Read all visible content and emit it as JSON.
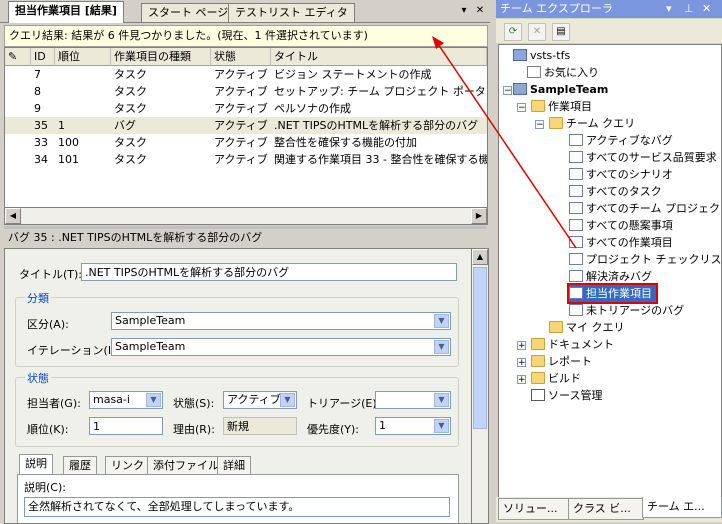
{
  "doc_tabs": [
    {
      "label": "担当作業項目 [結果]",
      "active": true
    },
    {
      "label": "スタート ページ",
      "active": false
    },
    {
      "label": "テストリスト エディタ",
      "active": false
    }
  ],
  "doc_controls": {
    "dropdown": "▾",
    "close": "✕"
  },
  "query_status": "クエリ結果: 結果が 6 件見つかりました。(現在、1 件選択されています)",
  "grid": {
    "columns": [
      "",
      "ID",
      "順位",
      "作業項目の種類",
      "状態",
      "タイトル"
    ],
    "rows": [
      {
        "id": "7",
        "rank": "",
        "type": "タスク",
        "state": "アクティブ",
        "title": "ビジョン ステートメントの作成",
        "selected": false
      },
      {
        "id": "8",
        "rank": "",
        "type": "タスク",
        "state": "アクティブ",
        "title": "セットアップ: チーム プロジェクト ポータルにプロ",
        "selected": false
      },
      {
        "id": "9",
        "rank": "",
        "type": "タスク",
        "state": "アクティブ",
        "title": "ペルソナの作成",
        "selected": false
      },
      {
        "id": "35",
        "rank": "1",
        "type": "バグ",
        "state": "アクティブ",
        "title": ".NET TIPSのHTMLを解析する部分のバグ",
        "selected": true
      },
      {
        "id": "33",
        "rank": "100",
        "type": "タスク",
        "state": "アクティブ",
        "title": "整合性を確保する機能の付加",
        "selected": false
      },
      {
        "id": "34",
        "rank": "101",
        "type": "タスク",
        "state": "アクティブ",
        "title": "関連する作業項目 33 - 整合性を確保する機",
        "selected": false
      }
    ]
  },
  "bug_header": "バグ 35 : .NET TIPSのHTMLを解析する部分のバグ",
  "form": {
    "title_label": "タイトル(T):",
    "title_value": ".NET TIPSのHTMLを解析する部分のバグ",
    "classification_group": "分類",
    "area_label": "区分(A):",
    "area_value": "SampleTeam",
    "iteration_label": "イテレーション(I):",
    "iteration_value": "SampleTeam",
    "status_group": "状態",
    "assigned_label": "担当者(G):",
    "assigned_value": "masa-i",
    "state_label": "状態(S):",
    "state_value": "アクティブ",
    "triage_label": "トリアージ(E):",
    "triage_value": "",
    "rank_label": "順位(K):",
    "rank_value": "1",
    "reason_label": "理由(R):",
    "reason_value": "新規",
    "priority_label": "優先度(Y):",
    "priority_value": "1",
    "tabs": [
      "説明",
      "履歴",
      "リンク",
      "添付ファイル",
      "詳細"
    ],
    "desc_label": "説明(C):",
    "desc_value": "全然解析されてなくて、全部処理してしまっています。"
  },
  "team_explorer": {
    "title": "チーム エクスプローラ",
    "title_controls": [
      "▾",
      "⊥",
      "✕"
    ],
    "tree": [
      {
        "label": "vsts-tfs",
        "icon": "server-icon",
        "level": 0,
        "expander": "",
        "bold": false
      },
      {
        "label": "お気に入り",
        "icon": "favorites-icon",
        "level": 1,
        "expander": "",
        "bold": false
      },
      {
        "label": "SampleTeam",
        "icon": "server-icon",
        "level": 0,
        "expander": "−",
        "bold": true
      },
      {
        "label": "作業項目",
        "icon": "folder-icon",
        "level": 1,
        "expander": "−",
        "bold": false
      },
      {
        "label": "チーム クエリ",
        "icon": "folder-icon",
        "level": 2,
        "expander": "−",
        "bold": false
      },
      {
        "label": "アクティブなバグ",
        "icon": "query-icon",
        "level": 3,
        "expander": "",
        "bold": false
      },
      {
        "label": "すべてのサービス品質要求",
        "icon": "query-icon",
        "level": 3,
        "expander": "",
        "bold": false
      },
      {
        "label": "すべてのシナリオ",
        "icon": "query-icon",
        "level": 3,
        "expander": "",
        "bold": false
      },
      {
        "label": "すべてのタスク",
        "icon": "query-icon",
        "level": 3,
        "expander": "",
        "bold": false
      },
      {
        "label": "すべてのチーム プロジェクト",
        "icon": "query-icon",
        "level": 3,
        "expander": "",
        "bold": false
      },
      {
        "label": "すべての懸案事項",
        "icon": "query-icon",
        "level": 3,
        "expander": "",
        "bold": false
      },
      {
        "label": "すべての作業項目",
        "icon": "query-icon",
        "level": 3,
        "expander": "",
        "bold": false
      },
      {
        "label": "プロジェクト チェックリスト",
        "icon": "query-icon",
        "level": 3,
        "expander": "",
        "bold": false
      },
      {
        "label": "解決済みバグ",
        "icon": "query-icon",
        "level": 3,
        "expander": "",
        "bold": false
      },
      {
        "label": "担当作業項目",
        "icon": "query-icon",
        "level": 3,
        "expander": "",
        "bold": false,
        "highlight": true
      },
      {
        "label": "未トリアージのバグ",
        "icon": "query-icon",
        "level": 3,
        "expander": "",
        "bold": false
      },
      {
        "label": "マイ クエリ",
        "icon": "folder-icon",
        "level": 2,
        "expander": "",
        "bold": false
      },
      {
        "label": "ドキュメント",
        "icon": "folder-icon",
        "level": 1,
        "expander": "+",
        "bold": false
      },
      {
        "label": "レポート",
        "icon": "folder-icon",
        "level": 1,
        "expander": "+",
        "bold": false
      },
      {
        "label": "ビルド",
        "icon": "folder-icon",
        "level": 1,
        "expander": "+",
        "bold": false
      },
      {
        "label": "ソース管理",
        "icon": "source-control-icon",
        "level": 1,
        "expander": "",
        "bold": false
      }
    ],
    "bottom_tabs": [
      "ソリュー...",
      "クラス ビ...",
      "チーム エ..."
    ]
  },
  "colors": {
    "highlight": "#e00000",
    "selection": "#316ac5",
    "title_bar": "#7a96df"
  }
}
